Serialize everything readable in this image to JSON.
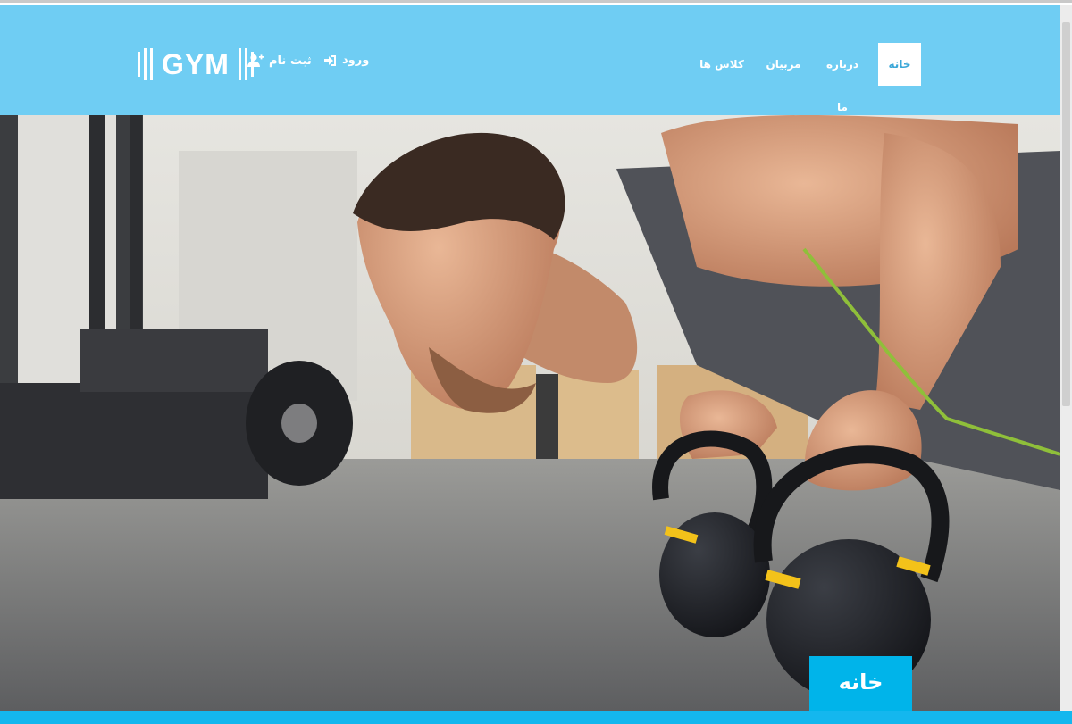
{
  "brand": {
    "logo_text": "GYM"
  },
  "auth": {
    "signup_label": "ثبت نام",
    "login_label": "ورود"
  },
  "nav": {
    "home": "خانه",
    "about": "درباره ما",
    "trainers": "مربیان",
    "classes": "کلاس ها"
  },
  "hero": {
    "section_label": "خانه"
  },
  "colors": {
    "navbar": "#6fcdf3",
    "accent": "#00b4ea",
    "bottom_bar": "#14b7ee"
  },
  "icons": {
    "signup": "user-plus-icon",
    "login": "sign-in-icon",
    "scroll": "chevron-down-icon"
  }
}
